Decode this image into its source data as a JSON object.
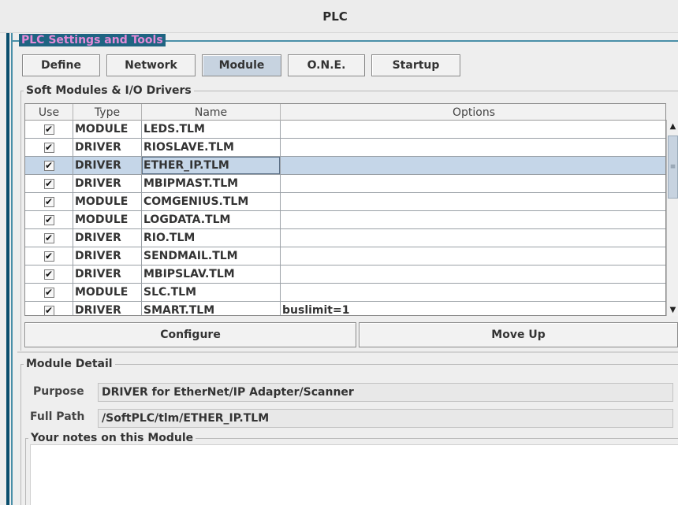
{
  "window": {
    "title": "PLC"
  },
  "settings_panel": {
    "label": "PLC Settings and Tools"
  },
  "tabs": [
    {
      "label": "Define"
    },
    {
      "label": "Network"
    },
    {
      "label": "Module",
      "active": true
    },
    {
      "label": "O.N.E."
    },
    {
      "label": "Startup"
    }
  ],
  "modules_panel": {
    "label": "Soft Modules & I/O Drivers",
    "columns": [
      "Use",
      "Type",
      "Name",
      "Options"
    ],
    "check_glyph": "✔",
    "rows": [
      {
        "type": "MODULE",
        "name": "LEDS.TLM",
        "options": "",
        "use": true
      },
      {
        "type": "DRIVER",
        "name": "RIOSLAVE.TLM",
        "options": "",
        "use": true
      },
      {
        "type": "DRIVER",
        "name": "ETHER_IP.TLM",
        "options": "",
        "use": true,
        "selected": true
      },
      {
        "type": "DRIVER",
        "name": "MBIPMAST.TLM",
        "options": "",
        "use": true
      },
      {
        "type": "MODULE",
        "name": "COMGENIUS.TLM",
        "options": "",
        "use": true
      },
      {
        "type": "MODULE",
        "name": "LOGDATA.TLM",
        "options": "",
        "use": true
      },
      {
        "type": "DRIVER",
        "name": "RIO.TLM",
        "options": "",
        "use": true
      },
      {
        "type": "DRIVER",
        "name": "SENDMAIL.TLM",
        "options": "",
        "use": true
      },
      {
        "type": "DRIVER",
        "name": "MBIPSLAV.TLM",
        "options": "",
        "use": true
      },
      {
        "type": "MODULE",
        "name": "SLC.TLM",
        "options": "",
        "use": true
      },
      {
        "type": "DRIVER",
        "name": "SMART.TLM",
        "options": "buslimit=1",
        "use": true
      }
    ],
    "configure_label": "Configure",
    "move_up_label": "Move Up"
  },
  "module_detail": {
    "label": "Module Detail",
    "purpose_label": "Purpose",
    "purpose_value": "DRIVER for EtherNet/IP Adapter/Scanner",
    "path_label": "Full Path",
    "path_value": "/SoftPLC/tlm/ETHER_IP.TLM",
    "notes_label": "Your notes on this Module",
    "notes_value": ""
  },
  "colors": {
    "accent_border": "#0b4f6e",
    "settings_label_bg": "#1f6482",
    "settings_label_text": "#e38ad7",
    "selection": "#c5d6e8",
    "active_tab": "#c7d3e0"
  }
}
